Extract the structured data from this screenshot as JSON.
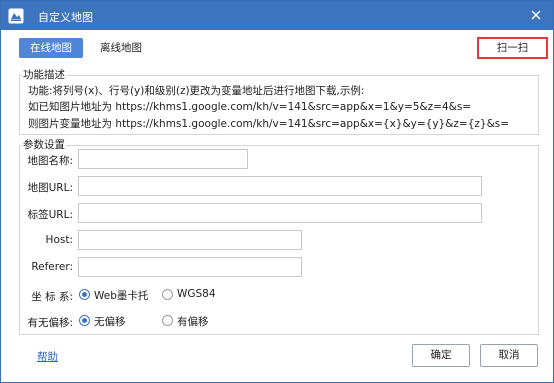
{
  "window": {
    "title": "自定义地图",
    "icon": "map-app-icon",
    "close_icon": "close-icon",
    "titlebar_color": "#3d74c0"
  },
  "tabs": [
    {
      "label": "在线地图",
      "active": true
    },
    {
      "label": "离线地图",
      "active": false
    }
  ],
  "scan_button": {
    "label": "扫一扫",
    "highlight_color": "#e53935"
  },
  "description": {
    "title": "功能描述",
    "lines": [
      "功能:将列号(x)、行号(y)和级别(z)更改为变量地址后进行地图下载,示例:",
      "如已知图片地址为 https://khms1.google.com/kh/v=141&src=app&x=1&y=5&z=4&s=",
      "则图片变量地址为 https://khms1.google.com/kh/v=141&src=app&x={x}&y={y}&z={z}&s="
    ]
  },
  "params": {
    "title": "参数设置",
    "map_name": {
      "label": "地图名称:",
      "value": ""
    },
    "map_url": {
      "label": "地图URL:",
      "value": ""
    },
    "label_url": {
      "label": "标签URL:",
      "value": ""
    },
    "host": {
      "label": "Host:",
      "value": ""
    },
    "referer": {
      "label": "Referer:",
      "value": ""
    },
    "coord_system": {
      "label": "坐 标 系:",
      "options": [
        {
          "label": "Web墨卡托",
          "checked": true
        },
        {
          "label": "WGS84",
          "checked": false
        }
      ]
    },
    "offset": {
      "label": "有无偏移:",
      "options": [
        {
          "label": "无偏移",
          "checked": true
        },
        {
          "label": "有偏移",
          "checked": false
        }
      ]
    }
  },
  "footer": {
    "help": "帮助",
    "ok": "确定",
    "cancel": "取消"
  }
}
